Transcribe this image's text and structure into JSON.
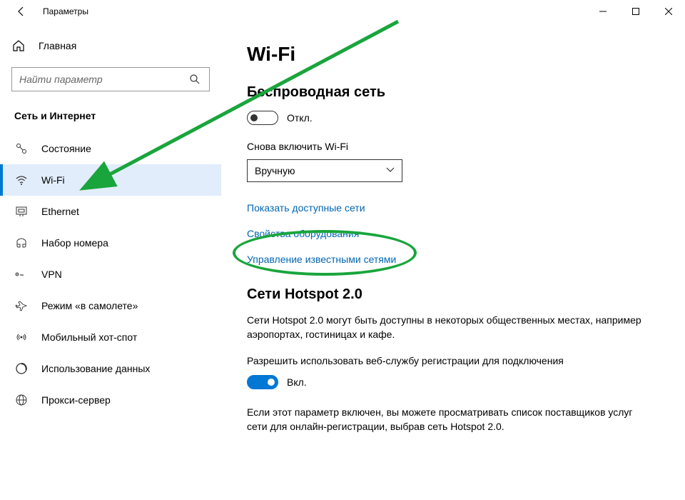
{
  "window": {
    "title": "Параметры"
  },
  "sidebar": {
    "home": "Главная",
    "search_placeholder": "Найти параметр",
    "section": "Сеть и Интернет",
    "items": [
      {
        "label": "Состояние"
      },
      {
        "label": "Wi-Fi"
      },
      {
        "label": "Ethernet"
      },
      {
        "label": "Набор номера"
      },
      {
        "label": "VPN"
      },
      {
        "label": "Режим «в самолете»"
      },
      {
        "label": "Мобильный хот-спот"
      },
      {
        "label": "Использование данных"
      },
      {
        "label": "Прокси-сервер"
      }
    ]
  },
  "main": {
    "title": "Wi-Fi",
    "wireless": {
      "heading": "Беспроводная сеть",
      "toggle_state": "Откл.",
      "reconnect_label": "Снова включить Wi-Fi",
      "reconnect_value": "Вручную"
    },
    "links": {
      "show_networks": "Показать доступные сети",
      "hardware_props": "Свойства оборудования",
      "manage_known": "Управление известными сетями"
    },
    "hotspot": {
      "heading": "Сети Hotspot 2.0",
      "desc": "Сети Hotspot 2.0 могут быть доступны в некоторых общественных местах, например аэропортах, гостиницах и кафе.",
      "allow_label": "Разрешить использовать веб-службу регистрации для подключения",
      "toggle_state": "Вкл.",
      "note": "Если этот параметр включен, вы можете просматривать список поставщиков услуг сети для онлайн-регистрации, выбрав сеть Hotspot 2.0."
    }
  },
  "annotation_color": "#19a53c"
}
